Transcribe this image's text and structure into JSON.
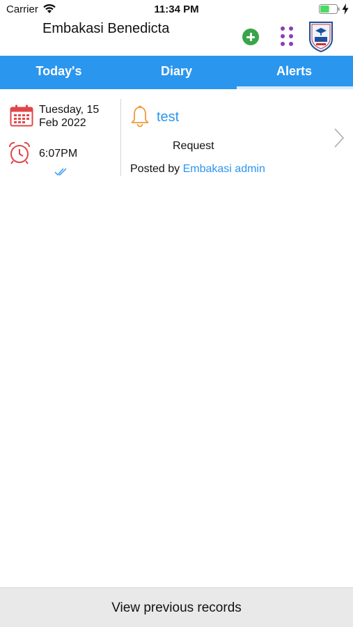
{
  "status_bar": {
    "carrier": "Carrier",
    "time": "11:34 PM",
    "battery_level": 0.55,
    "battery_color": "#4cd964"
  },
  "header": {
    "user_name": "Embakasi Benedicta",
    "add_icon": "plus-circle-icon",
    "menu_icon": "grid-dots-icon",
    "logo_icon": "school-crest-logo",
    "add_color": "#39a54a",
    "menu_color": "#8e3bb6"
  },
  "tabs": [
    {
      "label": "Today's",
      "active": false
    },
    {
      "label": "Diary",
      "active": false
    },
    {
      "label": "Alerts",
      "active": true
    }
  ],
  "alert": {
    "date": "Tuesday, 15 Feb 2022",
    "time": "6:07PM",
    "title": "test",
    "type": "Request",
    "posted_by_prefix": "Posted by",
    "posted_by_name": "Embakasi admin",
    "status_icon": "double-check-icon"
  },
  "colors": {
    "tab_bar": "#2b96ee",
    "link": "#2b96ee",
    "calendar_icon": "#e0464a",
    "bell_icon": "#f09a3a"
  },
  "footer": {
    "button_label": "View previous records"
  }
}
